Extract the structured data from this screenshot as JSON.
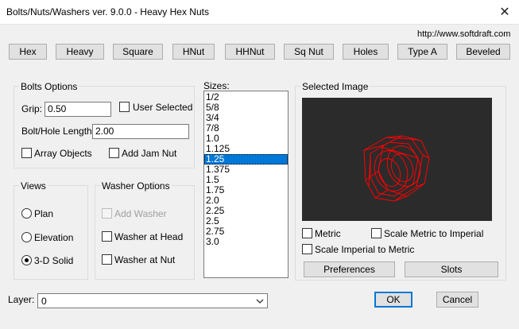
{
  "window": {
    "title": "Bolts/Nuts/Washers ver. 9.0.0 - Heavy Hex Nuts",
    "close_glyph": "✕"
  },
  "url": "http://www.softdraft.com",
  "toolbar": [
    "Hex",
    "Heavy",
    "Square",
    "HNut",
    "HHNut",
    "Sq Nut",
    "Holes",
    "Type A",
    "Beveled"
  ],
  "bolts_options": {
    "title": "Bolts Options",
    "grip_label": "Grip:",
    "grip_value": "0.50",
    "user_selected": "User Selected",
    "length_label": "Bolt/Hole Length:",
    "length_value": "2.00",
    "array_objects": "Array Objects",
    "add_jam_nut": "Add Jam Nut"
  },
  "views": {
    "title": "Views",
    "plan": "Plan",
    "elevation": "Elevation",
    "solid": "3-D Solid",
    "selected": "3-D Solid"
  },
  "washer_options": {
    "title": "Washer Options",
    "add_washer": "Add Washer",
    "washer_head": "Washer at Head",
    "washer_nut": "Washer at Nut"
  },
  "sizes": {
    "label": "Sizes:",
    "items": [
      "1/2",
      "5/8",
      "3/4",
      "7/8",
      "1.0",
      "1.125",
      "1.25",
      "1.375",
      "1.5",
      "1.75",
      "2.0",
      "2.25",
      "2.5",
      "2.75",
      "3.0"
    ],
    "selected": "1.25"
  },
  "selected_image": {
    "title": "Selected Image",
    "metric": "Metric",
    "scale_metric_imperial": "Scale Metric to Imperial",
    "scale_imperial_metric": "Scale Imperial to Metric",
    "preferences": "Preferences",
    "slots": "Slots",
    "wire_color": "#ff0000",
    "background": "#2b2b2b"
  },
  "layer": {
    "label": "Layer:",
    "value": "0"
  },
  "ok": "OK",
  "cancel": "Cancel"
}
